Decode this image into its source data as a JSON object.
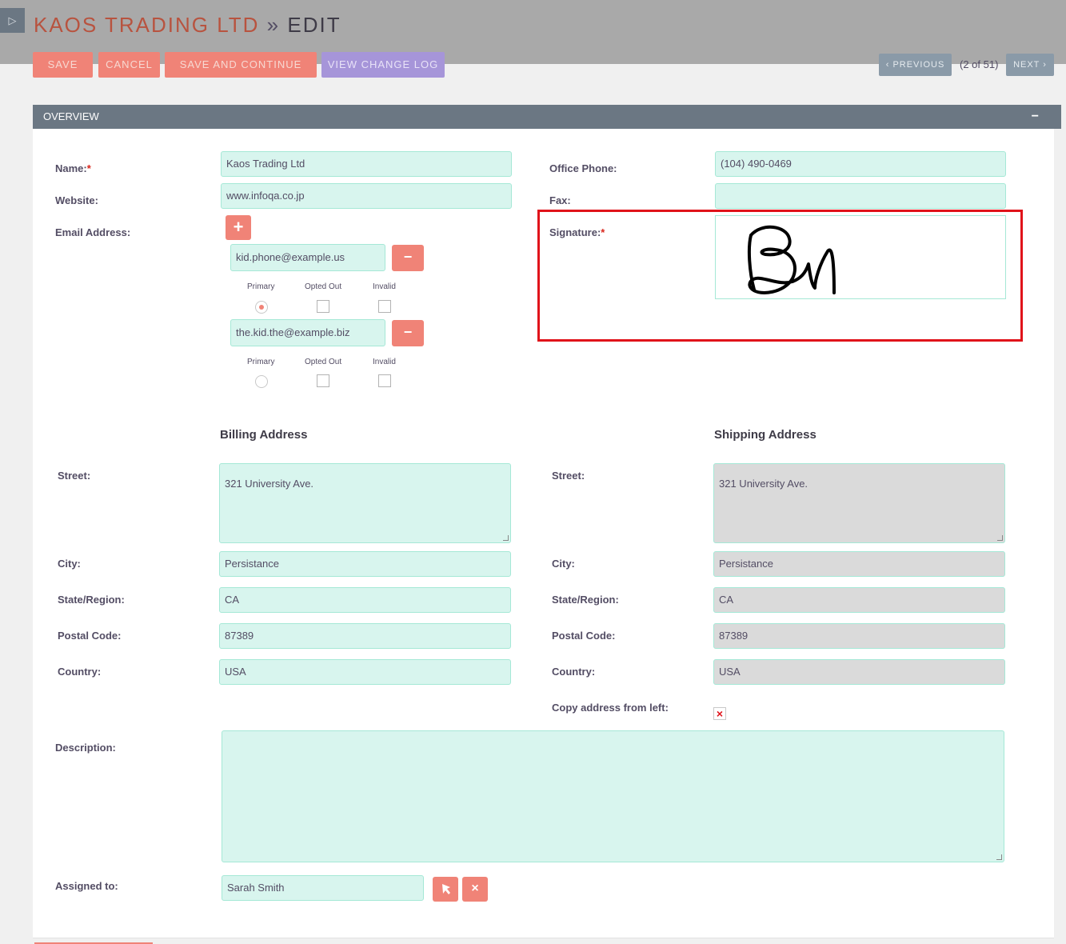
{
  "header": {
    "record_name": "KAOS TRADING LTD",
    "separator": "»",
    "mode": "EDIT",
    "sidebar_toggle": "▷"
  },
  "actions": {
    "save": "SAVE",
    "cancel": "CANCEL",
    "save_continue": "SAVE AND CONTINUE",
    "view_change_log": "VIEW CHANGE LOG"
  },
  "pagination": {
    "previous": "PREVIOUS",
    "next": "NEXT",
    "count": "(2 of 51)",
    "prev_icon": "‹",
    "next_icon": "›"
  },
  "panel": {
    "title": "OVERVIEW",
    "collapse_icon": "−"
  },
  "fields": {
    "name_label": "Name:",
    "name_value": "Kaos Trading Ltd",
    "website_label": "Website:",
    "website_value": "www.infoqa.co.jp",
    "email_label": "Email Address:",
    "office_phone_label": "Office Phone:",
    "office_phone_value": "(104) 490-0469",
    "fax_label": "Fax:",
    "fax_value": "",
    "signature_label": "Signature:",
    "required_mark": "*"
  },
  "emails": {
    "add_icon": "+",
    "remove_icon": "−",
    "option_labels": [
      "Primary",
      "Opted Out",
      "Invalid"
    ],
    "items": [
      {
        "address": "kid.phone@example.us",
        "primary": true,
        "opted_out": false,
        "invalid": false
      },
      {
        "address": "the.kid.the@example.biz",
        "primary": false,
        "opted_out": false,
        "invalid": false
      }
    ]
  },
  "billing": {
    "heading": "Billing Address",
    "street_label": "Street:",
    "street": "321 University Ave.",
    "city_label": "City:",
    "city": "Persistance",
    "state_label": "State/Region:",
    "state": "CA",
    "postal_label": "Postal Code:",
    "postal": "87389",
    "country_label": "Country:",
    "country": "USA"
  },
  "shipping": {
    "heading": "Shipping Address",
    "street_label": "Street:",
    "street": "321 University Ave.",
    "city_label": "City:",
    "city": "Persistance",
    "state_label": "State/Region:",
    "state": "CA",
    "postal_label": "Postal Code:",
    "postal": "87389",
    "country_label": "Country:",
    "country": "USA",
    "copy_label": "Copy address from left:",
    "copy_checked_icon": "×"
  },
  "description": {
    "label": "Description:",
    "value": ""
  },
  "assigned": {
    "label": "Assigned to:",
    "value": "Sarah Smith",
    "select_icon": "cursor-arrow-icon",
    "clear_icon": "×"
  },
  "colors": {
    "accent": "#f08377",
    "accent_purple": "#a695d9",
    "panel_header": "#6b7783",
    "input_bg": "#d8f5ee",
    "readonly_bg": "#dadada",
    "highlight": "#e0131a"
  }
}
